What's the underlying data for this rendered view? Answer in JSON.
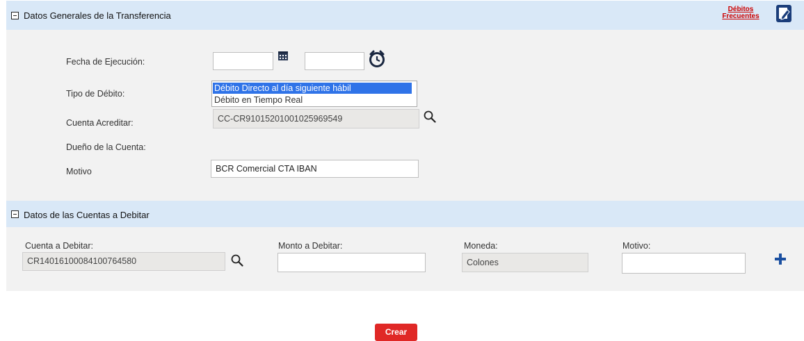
{
  "section1": {
    "title": "Datos Generales de la Transferencia",
    "frequent_link_line1": "Débitos",
    "frequent_link_line2": "Frecuentes",
    "fields": {
      "fecha_label": "Fecha de Ejecución:",
      "fecha_date_value": "",
      "fecha_time_value": "",
      "tipo_label": "Tipo de Débito:",
      "tipo_options": [
        "Débito Directo al día siguiente hábil",
        "Débito en Tiempo Real"
      ],
      "tipo_selected": "Débito Directo al día siguiente hábil",
      "cuenta_label": "Cuenta Acreditar:",
      "cuenta_value": "CC-CR91015201001025969549",
      "dueno_label": "Dueño de la Cuenta:",
      "motivo_label": "Motivo",
      "motivo_value": "BCR Comercial CTA IBAN"
    }
  },
  "section2": {
    "title": "Datos de las Cuentas a Debitar",
    "cuenta_label": "Cuenta a Debitar:",
    "cuenta_value": "CR14016100084100764580",
    "monto_label": "Monto a Debitar:",
    "monto_value": "",
    "moneda_label": "Moneda:",
    "moneda_value": "Colones",
    "motivo_label": "Motivo:",
    "motivo_value": ""
  },
  "actions": {
    "crear_label": "Crear"
  },
  "colors": {
    "header_bg": "#d9e8f7",
    "body_bg": "#f2f2f2",
    "accent_blue": "#1a4fa0",
    "link_red": "#cc0000",
    "button_red": "#e02826",
    "selection_blue": "#2f73e8"
  },
  "icons": [
    "collapse-icon",
    "edit-note-icon",
    "calendar-icon",
    "clock-icon",
    "search-icon",
    "add-icon"
  ]
}
